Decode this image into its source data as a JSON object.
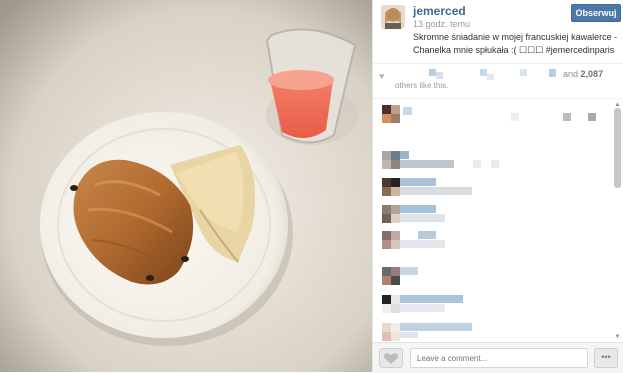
{
  "post": {
    "username": "jemerced",
    "time_ago": "13 godz. temu",
    "follow_label": "Obserwuj",
    "caption": "Skromne śniadanie w mojej francuskiej kawalerce - Chanelka mnie spłukała :( ☐☐☐ #jemercedinparis"
  },
  "likes": {
    "count_prefix": "and",
    "count": "2,087",
    "others_text": "others like this."
  },
  "comment_box": {
    "placeholder": "Leave a comment..."
  },
  "icons": {
    "heart": "heart-icon",
    "more": "more-dots-icon"
  },
  "colors": {
    "username": "#3b6a93",
    "follow_button": "#4a79a8"
  }
}
